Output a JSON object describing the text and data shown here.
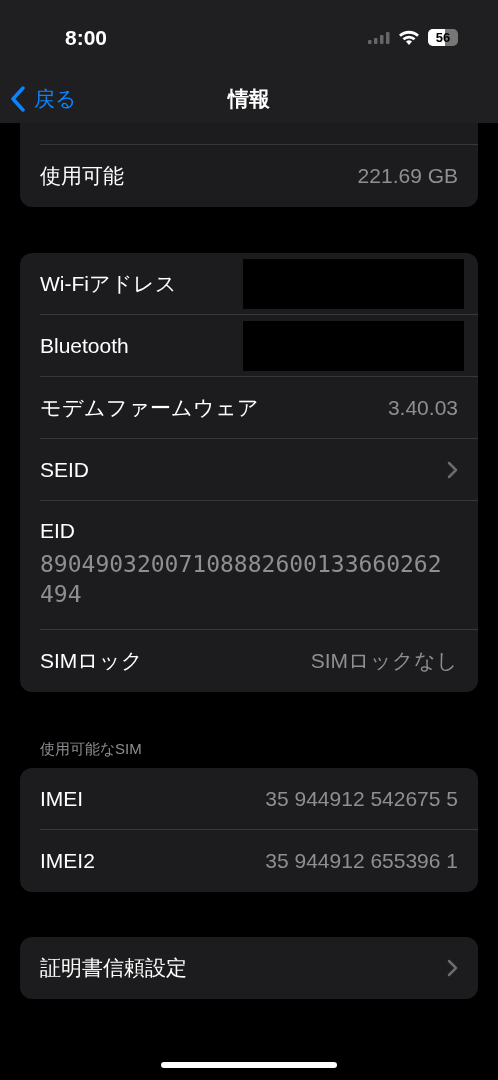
{
  "status_bar": {
    "time": "8:00",
    "battery": "56"
  },
  "nav": {
    "back": "戻る",
    "title": "情報"
  },
  "groups": [
    {
      "header_cut": true,
      "rows": [
        {
          "kind": "value",
          "label": "使用可能",
          "value": "221.69 GB"
        }
      ]
    },
    {
      "rows": [
        {
          "kind": "redacted",
          "label": "Wi-Fiアドレス"
        },
        {
          "kind": "redacted",
          "label": "Bluetooth"
        },
        {
          "kind": "value",
          "label": "モデムファームウェア",
          "value": "3.40.03"
        },
        {
          "kind": "link",
          "label": "SEID"
        },
        {
          "kind": "stacked",
          "label": "EID",
          "value": "89049032007108882600133660262494"
        },
        {
          "kind": "value",
          "label": "SIMロック",
          "value": "SIMロックなし"
        }
      ]
    },
    {
      "header": "使用可能なSIM",
      "rows": [
        {
          "kind": "value",
          "label": "IMEI",
          "value": "35 944912 542675 5"
        },
        {
          "kind": "value",
          "label": "IMEI2",
          "value": "35 944912 655396 1"
        }
      ]
    },
    {
      "rows": [
        {
          "kind": "link",
          "label": "証明書信頼設定"
        }
      ]
    }
  ]
}
